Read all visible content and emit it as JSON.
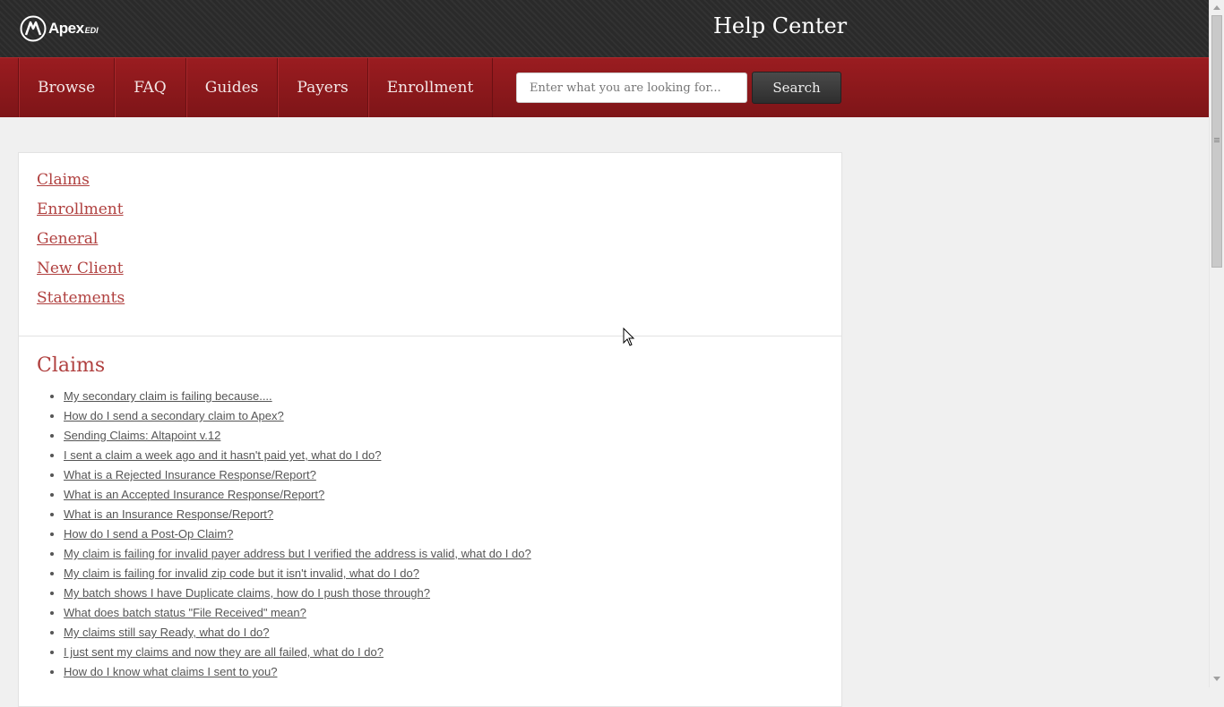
{
  "header": {
    "logo_text": "Apex",
    "logo_sub": "EDI",
    "title": "Help Center"
  },
  "nav": {
    "items": [
      {
        "label": "Browse"
      },
      {
        "label": "FAQ"
      },
      {
        "label": "Guides"
      },
      {
        "label": "Payers"
      },
      {
        "label": "Enrollment"
      }
    ]
  },
  "search": {
    "placeholder": "Enter what you are looking for...",
    "button_label": "Search"
  },
  "categories": [
    {
      "label": "Claims"
    },
    {
      "label": "Enrollment"
    },
    {
      "label": "General"
    },
    {
      "label": "New Client"
    },
    {
      "label": "Statements"
    }
  ],
  "section": {
    "title": "Claims",
    "questions": [
      {
        "label": "My secondary claim is failing because...."
      },
      {
        "label": "How do I send a secondary claim to Apex?"
      },
      {
        "label": "Sending Claims: Altapoint v.12"
      },
      {
        "label": "I sent a claim a week ago and it hasn't paid yet, what do I do?"
      },
      {
        "label": "What is a Rejected Insurance Response/Report?"
      },
      {
        "label": "What is an Accepted Insurance Response/Report?"
      },
      {
        "label": "What is an Insurance Response/Report?"
      },
      {
        "label": "How do I send a Post-Op Claim?"
      },
      {
        "label": "My claim is failing for invalid payer address but I verified the address is valid, what do I do?"
      },
      {
        "label": "My claim is failing for invalid zip code but it isn't invalid, what do I do?"
      },
      {
        "label": "My batch shows I have Duplicate claims, how do I push those through?"
      },
      {
        "label": "What does batch status \"File Received\" mean?"
      },
      {
        "label": "My claims still say Ready, what do I do?"
      },
      {
        "label": "I just sent my claims and now they are all failed, what do I do?"
      },
      {
        "label": "How do I know what claims I sent to you?"
      }
    ]
  }
}
